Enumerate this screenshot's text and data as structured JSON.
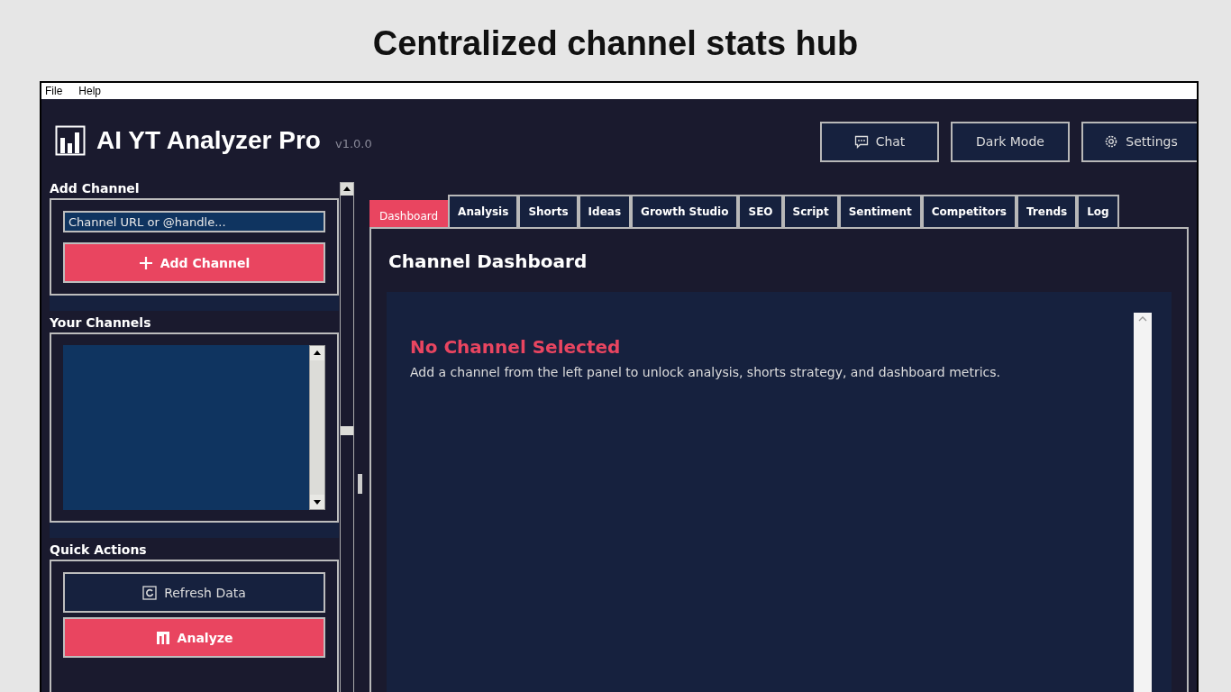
{
  "page_title": "Centralized channel stats hub",
  "menu": [
    "File",
    "Help"
  ],
  "app": {
    "title": "AI YT Analyzer Pro",
    "version": "v1.0.0"
  },
  "header_buttons": [
    {
      "label": "Chat",
      "kind": "chat"
    },
    {
      "label": "Dark Mode",
      "kind": "plain"
    },
    {
      "label": "Settings",
      "kind": "settings"
    }
  ],
  "sidebar": {
    "add_channel": {
      "heading": "Add Channel",
      "placeholder": "Channel URL or @handle...",
      "button": "Add Channel"
    },
    "your_channels": {
      "heading": "Your Channels"
    },
    "quick_actions": {
      "heading": "Quick Actions",
      "buttons": [
        {
          "label": "Refresh Data",
          "kind": "secondary"
        },
        {
          "label": "Analyze",
          "kind": "primary"
        }
      ]
    }
  },
  "tabs": [
    {
      "label": "Dashboard",
      "selected": true
    },
    {
      "label": "Analysis",
      "selected": false
    },
    {
      "label": "Shorts",
      "selected": false
    },
    {
      "label": "Ideas",
      "selected": false
    },
    {
      "label": "Growth Studio",
      "selected": false
    },
    {
      "label": "SEO",
      "selected": false
    },
    {
      "label": "Script",
      "selected": false
    },
    {
      "label": "Sentiment",
      "selected": false
    },
    {
      "label": "Competitors",
      "selected": false
    },
    {
      "label": "Trends",
      "selected": false
    },
    {
      "label": "Log",
      "selected": false
    }
  ],
  "dashboard": {
    "title": "Channel Dashboard",
    "empty_title": "No Channel Selected",
    "empty_text": "Add a channel from the left panel to unlock analysis, shorts strategy, and dashboard metrics."
  }
}
